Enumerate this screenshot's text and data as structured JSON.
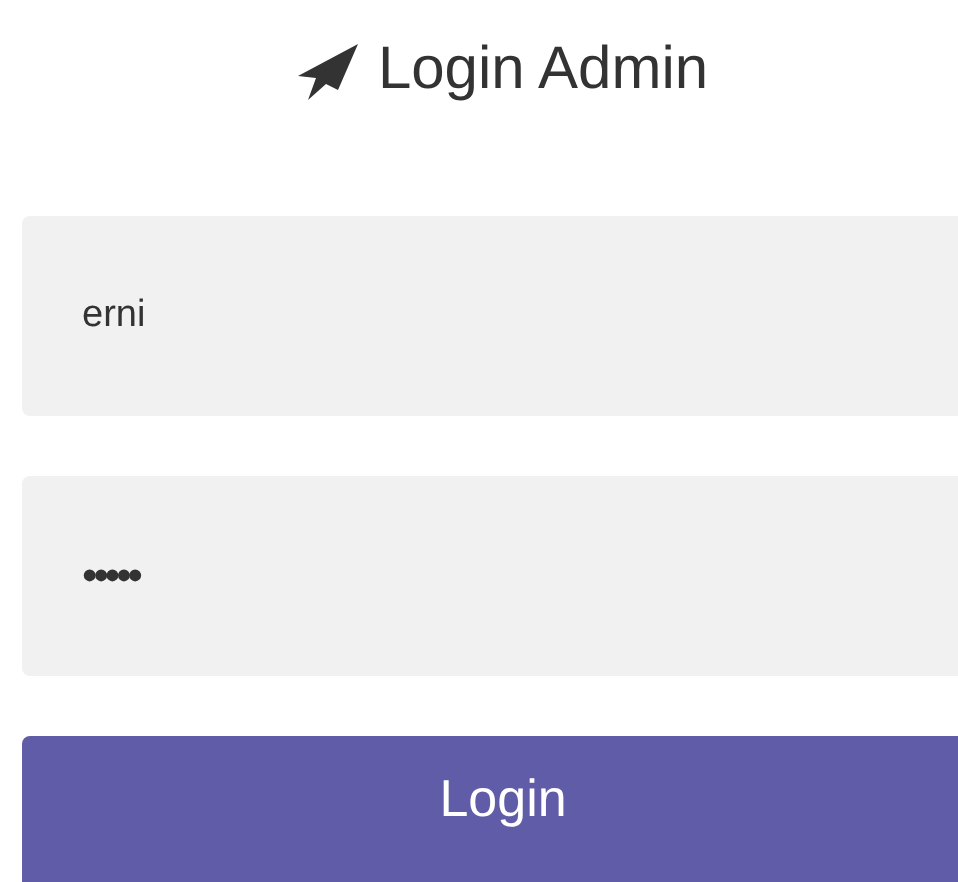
{
  "title": "Login Admin",
  "fields": [
    {
      "kind": "text",
      "value": "erni"
    },
    {
      "kind": "password",
      "value": "•••••"
    }
  ],
  "button": {
    "label": "Login"
  }
}
